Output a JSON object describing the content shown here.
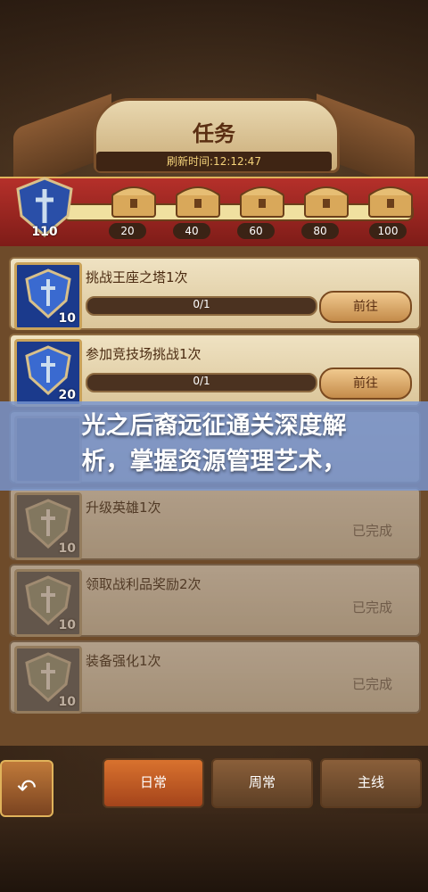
{
  "header": {
    "title": "任务",
    "refresh_text": "刷新时间:12:12:47"
  },
  "progress": {
    "player_level": "110",
    "chests": [
      {
        "score": "20"
      },
      {
        "score": "40"
      },
      {
        "score": "60"
      },
      {
        "score": "80"
      },
      {
        "score": "100"
      }
    ]
  },
  "tasks": [
    {
      "title": "挑战王座之塔1次",
      "level": "10",
      "progress": "0/1",
      "action": "前往"
    },
    {
      "title": "参加竞技场挑战1次",
      "level": "20",
      "progress": "0/1",
      "action": "前往"
    },
    {
      "title": "升级英雄1次",
      "level": "10",
      "status": "已完成"
    },
    {
      "title": "领取战利品奖励2次",
      "level": "10",
      "status": "已完成"
    },
    {
      "title": "装备强化1次",
      "level": "10",
      "status": "已完成"
    }
  ],
  "overlay": {
    "line1": "光之后裔远征通关深度解",
    "line2": "析，掌握资源管理艺术，"
  },
  "tabs": [
    {
      "label": "日常"
    },
    {
      "label": "周常"
    },
    {
      "label": "主线"
    }
  ],
  "colors": {
    "accent": "#c9a25a",
    "ribbon": "#b5302a",
    "overlay": "#7896d2"
  }
}
